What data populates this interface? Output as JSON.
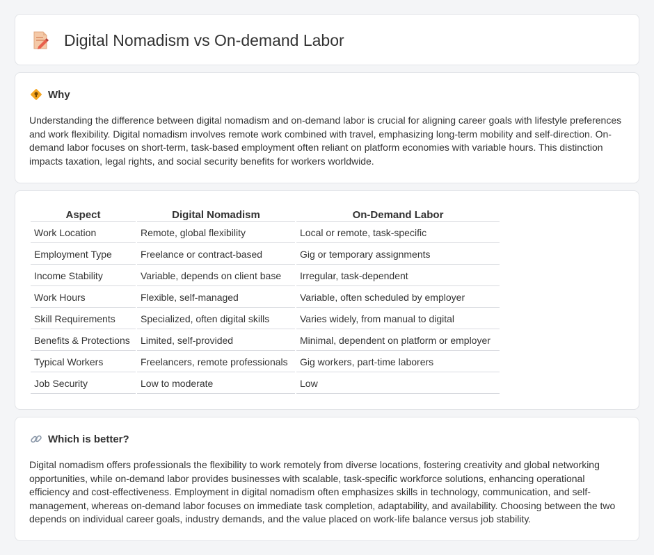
{
  "header": {
    "title": "Digital Nomadism vs On-demand Labor",
    "icon": "document-pencil-icon"
  },
  "why": {
    "heading": "Why",
    "icon": "lightbulb-diamond-icon",
    "text": "Understanding the difference between digital nomadism and on-demand labor is crucial for aligning career goals with lifestyle preferences and work flexibility. Digital nomadism involves remote work combined with travel, emphasizing long-term mobility and self-direction. On-demand labor focuses on short-term, task-based employment often reliant on platform economies with variable hours. This distinction impacts taxation, legal rights, and social security benefits for workers worldwide."
  },
  "table": {
    "headers": [
      "Aspect",
      "Digital Nomadism",
      "On-Demand Labor"
    ],
    "rows": [
      [
        "Work Location",
        "Remote, global flexibility",
        "Local or remote, task-specific"
      ],
      [
        "Employment Type",
        "Freelance or contract-based",
        "Gig or temporary assignments"
      ],
      [
        "Income Stability",
        "Variable, depends on client base",
        "Irregular, task-dependent"
      ],
      [
        "Work Hours",
        "Flexible, self-managed",
        "Variable, often scheduled by employer"
      ],
      [
        "Skill Requirements",
        "Specialized, often digital skills",
        "Varies widely, from manual to digital"
      ],
      [
        "Benefits & Protections",
        "Limited, self-provided",
        "Minimal, dependent on platform or employer"
      ],
      [
        "Typical Workers",
        "Freelancers, remote professionals",
        "Gig workers, part-time laborers"
      ],
      [
        "Job Security",
        "Low to moderate",
        "Low"
      ]
    ]
  },
  "better": {
    "heading": "Which is better?",
    "icon": "link-icon",
    "text": "Digital nomadism offers professionals the flexibility to work remotely from diverse locations, fostering creativity and global networking opportunities, while on-demand labor provides businesses with scalable, task-specific workforce solutions, enhancing operational efficiency and cost-effectiveness. Employment in digital nomadism often emphasizes skills in technology, communication, and self-management, whereas on-demand labor focuses on immediate task completion, adaptability, and availability. Choosing between the two depends on individual career goals, industry demands, and the value placed on work-life balance versus job stability."
  }
}
